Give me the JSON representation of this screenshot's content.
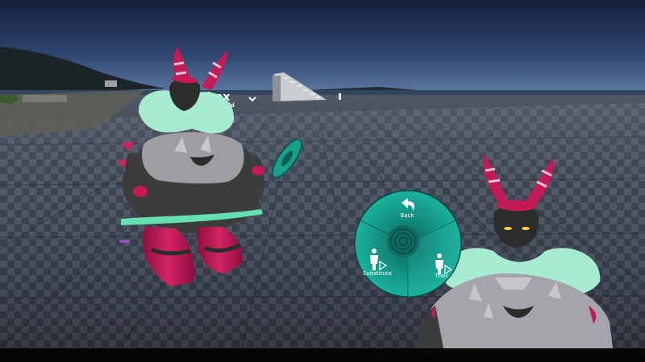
{
  "world_sign": {
    "title": "tbox",
    "subtitle": "t World"
  },
  "action_menu": {
    "back_label": "Back",
    "left_label": "Substitute",
    "right_label": "Toxic"
  },
  "colors": {
    "sky_top": "#1a2540",
    "sky_horizon": "#5d7aa2",
    "floor_dark": "#2e3340",
    "floor_light": "#5e6674",
    "menu_teal": "#17a08d",
    "menu_teal_dark": "#0f6f63",
    "avatar_red": "#c21a55",
    "avatar_fur": "#a6ecd2",
    "avatar_grey": "#9a9a9f",
    "avatar_dark": "#3a3d3a"
  },
  "icons": {
    "back": "back-arrow-icon",
    "substitute": "person-play-icon",
    "toxic": "person-play-icon",
    "center": "spiral-icon"
  }
}
